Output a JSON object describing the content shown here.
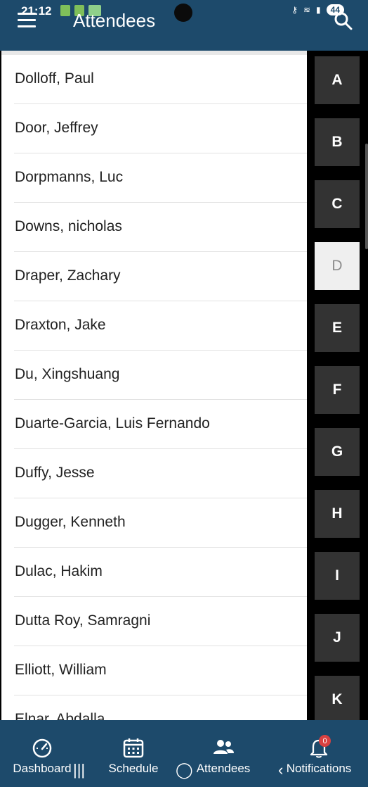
{
  "status_bar": {
    "time": "21:12",
    "battery": "44"
  },
  "header": {
    "title": "Attendees"
  },
  "attendees": [
    "Dolloff, Paul",
    "Door, Jeffrey",
    "Dorpmanns, Luc",
    "Downs, nicholas",
    "Draper, Zachary",
    "Draxton, Jake",
    "Du, Xingshuang",
    "Duarte-Garcia, Luis Fernando",
    "Duffy, Jesse",
    "Dugger, Kenneth",
    "Dulac, Hakim",
    "Dutta Roy, Samragni",
    "Elliott, William",
    "Elnar, Abdalla"
  ],
  "index_letters": [
    "A",
    "B",
    "C",
    "D",
    "E",
    "F",
    "G",
    "H",
    "I",
    "J",
    "K"
  ],
  "active_letter": "D",
  "bottom_nav": [
    {
      "label": "Dashboard",
      "icon": "gauge-icon"
    },
    {
      "label": "Schedule",
      "icon": "calendar-icon"
    },
    {
      "label": "Attendees",
      "icon": "people-icon"
    },
    {
      "label": "Notifications",
      "icon": "bell-icon",
      "badge": "0"
    }
  ],
  "colors": {
    "bar": "#1d4a6b",
    "rail_tile": "#333333",
    "active_tile": "#efefef",
    "badge": "#d94141"
  }
}
